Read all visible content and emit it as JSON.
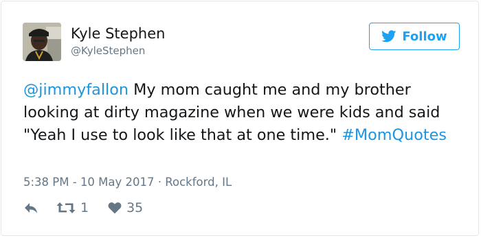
{
  "user": {
    "name": "Kyle Stephen",
    "handle": "@KyleStephen"
  },
  "follow_button": {
    "label": "Follow",
    "icon": "twitter-bird-icon"
  },
  "tweet": {
    "mention": "@jimmyfallon",
    "text": " My mom caught me and my brother looking at dirty magazine when we were kids and said \"Yeah I use to look like that at one time.\" ",
    "hashtag": "#MomQuotes"
  },
  "meta": {
    "time": "5:38 PM",
    "separator": " - ",
    "date": "10 May 2017",
    "dot": " · ",
    "location": "Rockford, IL"
  },
  "actions": {
    "reply_icon": "reply-icon",
    "retweet_icon": "retweet-icon",
    "retweet_count": "1",
    "like_icon": "heart-icon",
    "like_count": "35"
  },
  "colors": {
    "link": "#1b95e0",
    "brand": "#1da1f2",
    "muted": "#657786",
    "text": "#14171a",
    "border": "#e1e8ed"
  }
}
